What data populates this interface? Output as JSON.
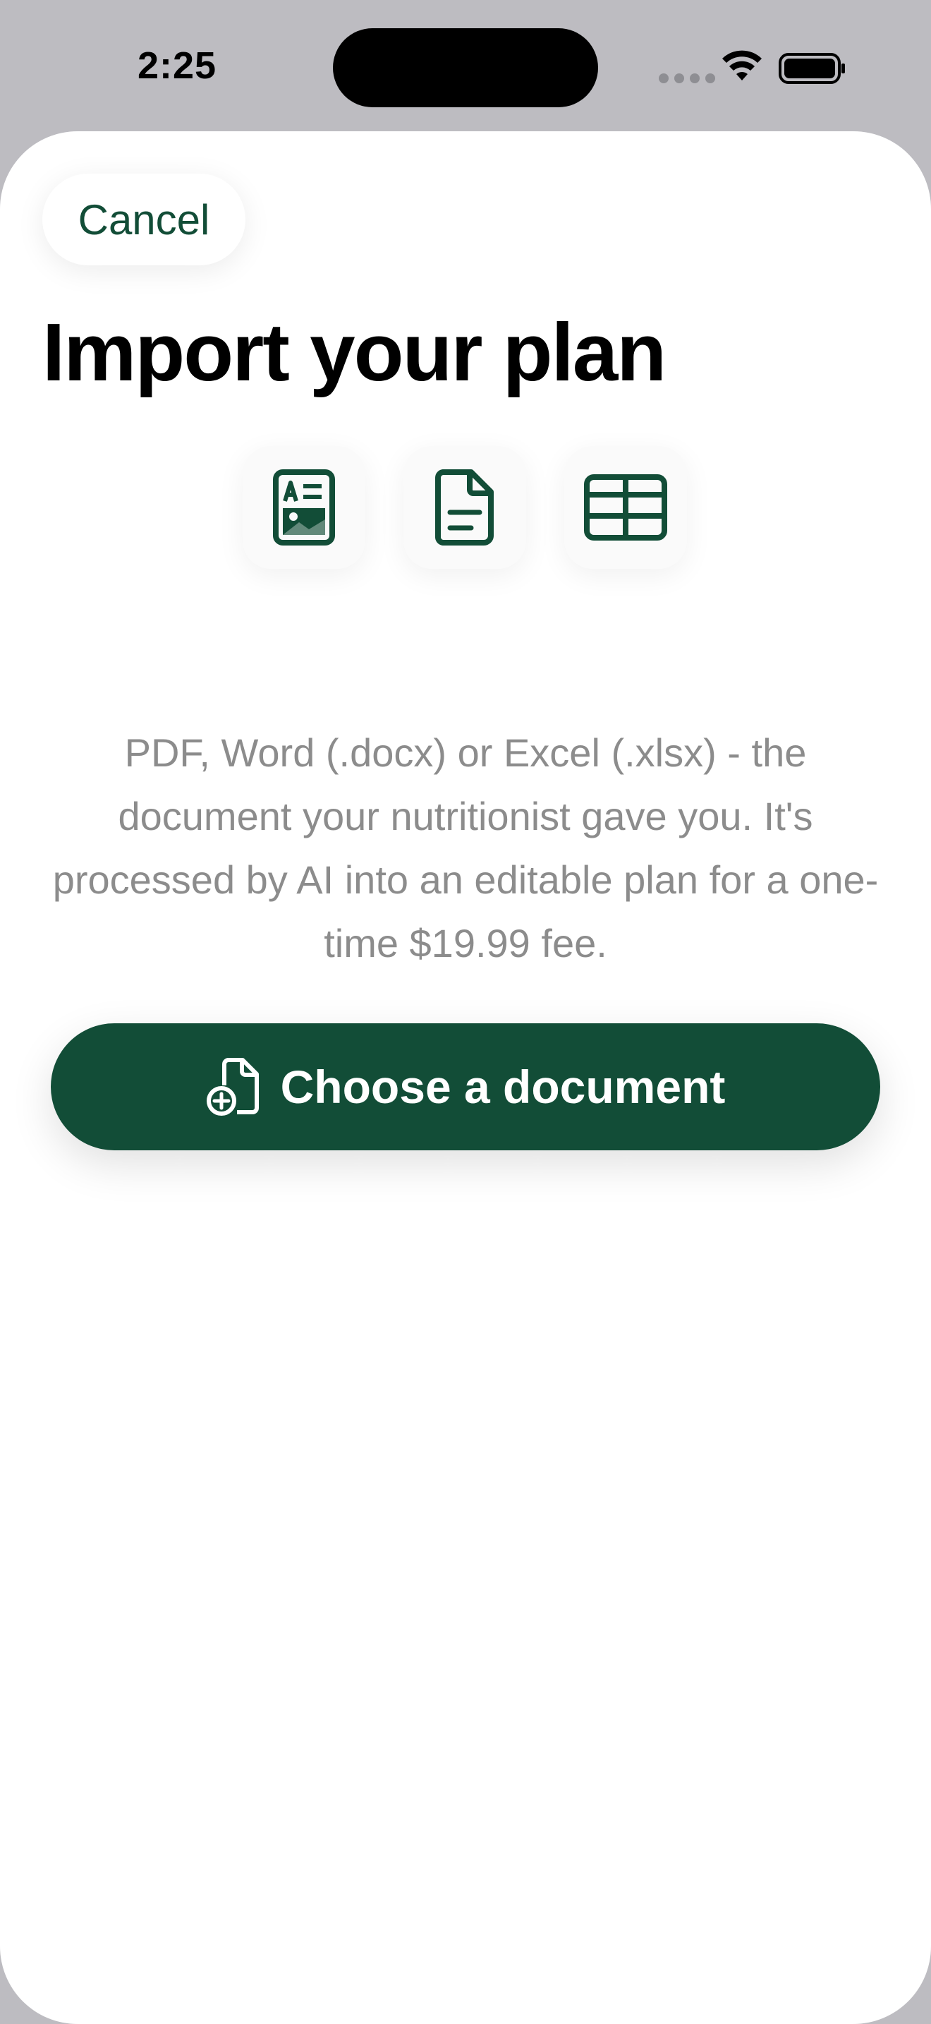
{
  "status_bar": {
    "time": "2:25",
    "icons": [
      "cellular-signal-icon",
      "wifi-icon",
      "battery-icon"
    ]
  },
  "sheet": {
    "cancel_label": "Cancel",
    "title": "Import your plan",
    "format_icons": [
      "pdf-document-icon",
      "word-document-icon",
      "spreadsheet-icon"
    ],
    "description": "PDF, Word (.docx) or Excel (.xlsx) - the document your nutritionist gave you. It's processed by AI into an editable plan for a one-time $19.99 fee.",
    "choose_button_label": "Choose a document",
    "choose_button_icon": "document-add-icon"
  },
  "colors": {
    "accent": "#124d37",
    "background": "#bdbcc1",
    "sheet": "#ffffff",
    "secondary_text": "#8c8c8c"
  }
}
